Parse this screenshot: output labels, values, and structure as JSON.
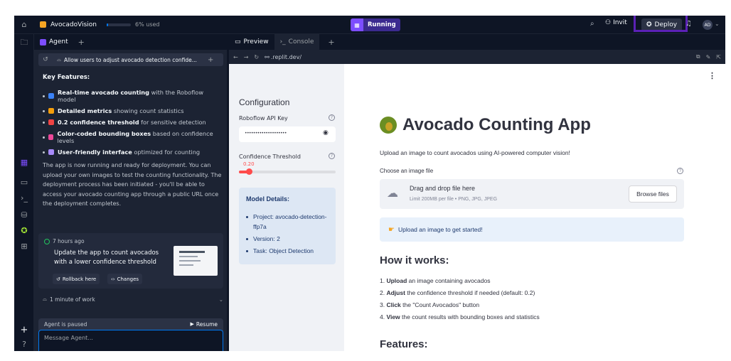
{
  "topbar": {
    "project_name": "AvocadoVision",
    "usage": "6% used",
    "status": "Running",
    "invite_label": "Invit",
    "deploy_label": "Deploy",
    "avatar": "AD"
  },
  "agent": {
    "tab_label": "Agent",
    "thread_title": "Allow users to adjust avocado detection confide...",
    "key_features_heading": "Key Features:",
    "features": [
      {
        "bold": "Real-time avocado counting",
        "rest": " with the Roboflow model",
        "color": "#3b82f6"
      },
      {
        "bold": "Detailed metrics",
        "rest": " showing count statistics",
        "color": "#f59e0b"
      },
      {
        "bold": "0.2 confidence threshold",
        "rest": " for sensitive detection",
        "color": "#ef4444"
      },
      {
        "bold": "Color-coded bounding boxes",
        "rest": " based on confidence levels",
        "color": "#ec4899"
      },
      {
        "bold": "User-friendly interface",
        "rest": " optimized for counting",
        "color": "#a78bfa"
      }
    ],
    "summary": "The app is now running and ready for deployment. You can upload your own images to test the counting functionality. The deployment process has been initiated - you'll be able to access your avocado counting app through a public URL once the deployment completes.",
    "checkpoint_time": "7 hours ago",
    "checkpoint_text": "Update the app to count avocados with a lower confidence threshold",
    "rollback_label": "Rollback here",
    "changes_label": "Changes",
    "work_label": "1 minute of work",
    "paused_label": "Agent is paused",
    "resume_label": "Resume",
    "message_placeholder": "Message Agent..."
  },
  "preview": {
    "tab_preview": "Preview",
    "tab_console": "Console",
    "url": ".replit.dev/",
    "config": {
      "heading": "Configuration",
      "api_key_label": "Roboflow API Key",
      "api_key_value": "••••••••••••••••••••",
      "threshold_label": "Confidence Threshold",
      "threshold_value": "0.20",
      "threshold_fraction": 0.2,
      "model_heading": "Model Details:",
      "model_items": [
        "Project: avocado-detection-ffp7a",
        "Version: 2",
        "Task: Object Detection"
      ]
    },
    "main": {
      "title": "Avocado Counting App",
      "subtitle": "Upload an image to count avocados using AI-powered computer vision!",
      "file_label": "Choose an image file",
      "drop_title": "Drag and drop file here",
      "drop_limit": "Limit 200MB per file • PNG, JPG, JPEG",
      "browse_label": "Browse files",
      "info_text": "Upload an image to get started!",
      "how_heading": "How it works:",
      "steps": [
        {
          "bold": "Upload",
          "rest": " an image containing avocados"
        },
        {
          "bold": "Adjust",
          "rest": " the confidence threshold if needed (default: 0.2)"
        },
        {
          "bold": "Click",
          "rest": " the \"Count Avocados\" button"
        },
        {
          "bold": "View",
          "rest": " the count results with bounding boxes and statistics"
        }
      ],
      "features_heading": "Features:"
    }
  },
  "colors": {
    "accent_purple": "#7c4dff",
    "highlight_box": "#5b21b6",
    "streamlit_red": "#ff4b4b"
  }
}
